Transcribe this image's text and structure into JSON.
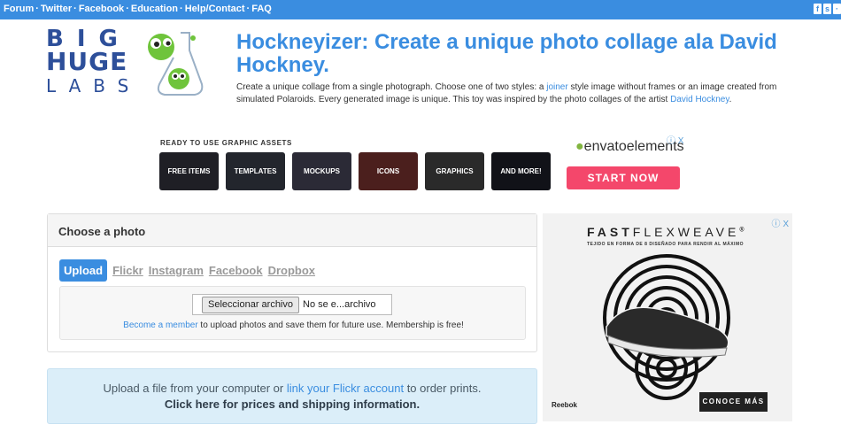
{
  "topbar": {
    "links": [
      "Forum",
      "Twitter",
      "Facebook",
      "Education",
      "Help/Contact",
      "FAQ"
    ],
    "separator": "·",
    "social_icons": [
      "facebook-icon",
      "stumbleupon-icon",
      "other-icon"
    ]
  },
  "logo": {
    "line1": "BIG",
    "line2": "HUGE",
    "line3": "LABS"
  },
  "header": {
    "title": "Hockneyizer: Create a unique photo collage ala David Hockney.",
    "desc_1": "Create a unique collage from a single photograph. Choose one of two styles: a ",
    "desc_link_1": "joiner",
    "desc_2": " style image without frames or an image created from simulated Polaroids. Every generated image is unique. This toy was inspired by the photo collages of the artist ",
    "desc_link_2": "David Hockney",
    "desc_3": "."
  },
  "envato_ad": {
    "heading": "READY TO USE GRAPHIC ASSETS",
    "tiles": [
      "FREE ITEMS",
      "TEMPLATES",
      "MOCKUPS",
      "ICONS",
      "GRAPHICS",
      "AND MORE!"
    ],
    "logo_a": "envato",
    "logo_b": "elements",
    "cta": "START NOW",
    "close": "ⓘ X"
  },
  "choose_photo": {
    "title": "Choose a photo",
    "tabs": [
      "Upload",
      "Flickr",
      "Instagram",
      "Facebook",
      "Dropbox"
    ],
    "active_tab": "Upload",
    "file_button": "Seleccionar archivo",
    "file_status": "No se e...archivo",
    "member_link": "Become a member",
    "member_text": " to upload photos and save them for future use. Membership is free!"
  },
  "prints": {
    "text_a": "Upload a file from your computer or ",
    "link": "link your Flickr account",
    "text_b": " to order prints.",
    "line2": "Click here for prices and shipping information."
  },
  "reebok_ad": {
    "brand_a": "FAST",
    "brand_b": "FLEXWEAVE",
    "brand_mark": "®",
    "tagline": "TEJIDO EN FORMA DE 8 DISEÑADO PARA RENDIR AL MÁXIMO",
    "cta": "CONOCE MÁS",
    "logo": "Reebok",
    "close": "ⓘ X"
  },
  "colors": {
    "topbar": "#3a8de0",
    "title": "#3a8de0",
    "logo": "#2d4f9a",
    "start_now": "#f4476b",
    "prints_bg": "#dbeef9"
  }
}
